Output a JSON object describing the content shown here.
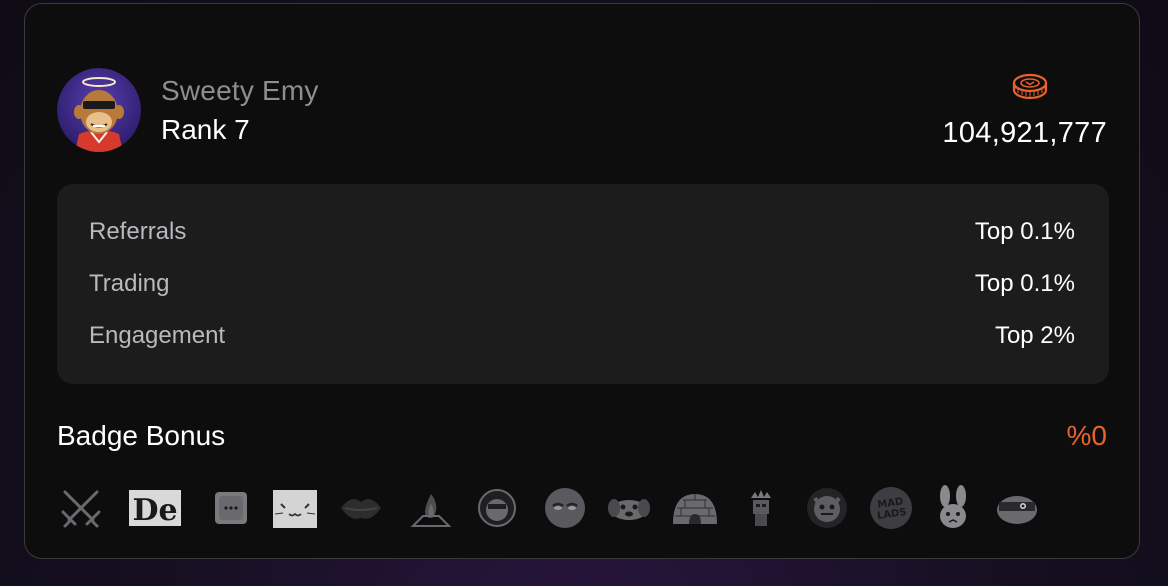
{
  "profile": {
    "name": "Sweety Emy",
    "rank": "Rank 7",
    "avatar_icon": "ape-avatar-icon"
  },
  "points": {
    "icon": "coin-icon",
    "value": "104,921,777",
    "icon_color": "#e8622c"
  },
  "stats": [
    {
      "label": "Referrals",
      "value": "Top 0.1%"
    },
    {
      "label": "Trading",
      "value": "Top 0.1%"
    },
    {
      "label": "Engagement",
      "value": "Top 2%"
    }
  ],
  "badge_bonus": {
    "label": "Badge Bonus",
    "value": "%0",
    "value_color": "#e8622c"
  },
  "badges": [
    "crossed-swords-icon",
    "de-logo-icon",
    "chat-bubble-icon",
    "cat-face-icon",
    "lips-icon",
    "campfire-icon",
    "hooded-face-icon",
    "moon-face-icon",
    "dog-face-icon",
    "igloo-icon",
    "crowned-figure-icon",
    "monster-face-icon",
    "mad-lads-icon",
    "bunny-icon",
    "ninja-icon"
  ]
}
